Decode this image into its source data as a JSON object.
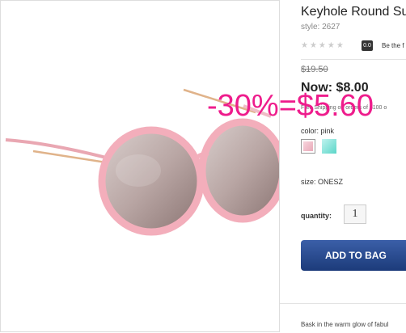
{
  "product": {
    "title": "Keyhole Round Sun",
    "style": "style: 2627",
    "stars": "★★★★★",
    "rating": "0.0",
    "review_link": "Be the f"
  },
  "pricing": {
    "old_price": "$19.50",
    "now_price": "Now: $8.00",
    "shipping": "Free Shipping on orders of $100 o"
  },
  "options": {
    "color_label": "color: pink",
    "swatches": [
      "pink",
      "teal"
    ],
    "size_label": "size: ONESZ",
    "quantity_label": "quantity:",
    "quantity_value": "1"
  },
  "actions": {
    "add_to_bag": "ADD TO BAG"
  },
  "description": "Bask in the warm glow of fabul",
  "promo": "-30%=$5.60",
  "colors": {
    "promo": "#ee1c8c",
    "button": "#1c3b7a",
    "frame_pink": "#f3aebb"
  }
}
